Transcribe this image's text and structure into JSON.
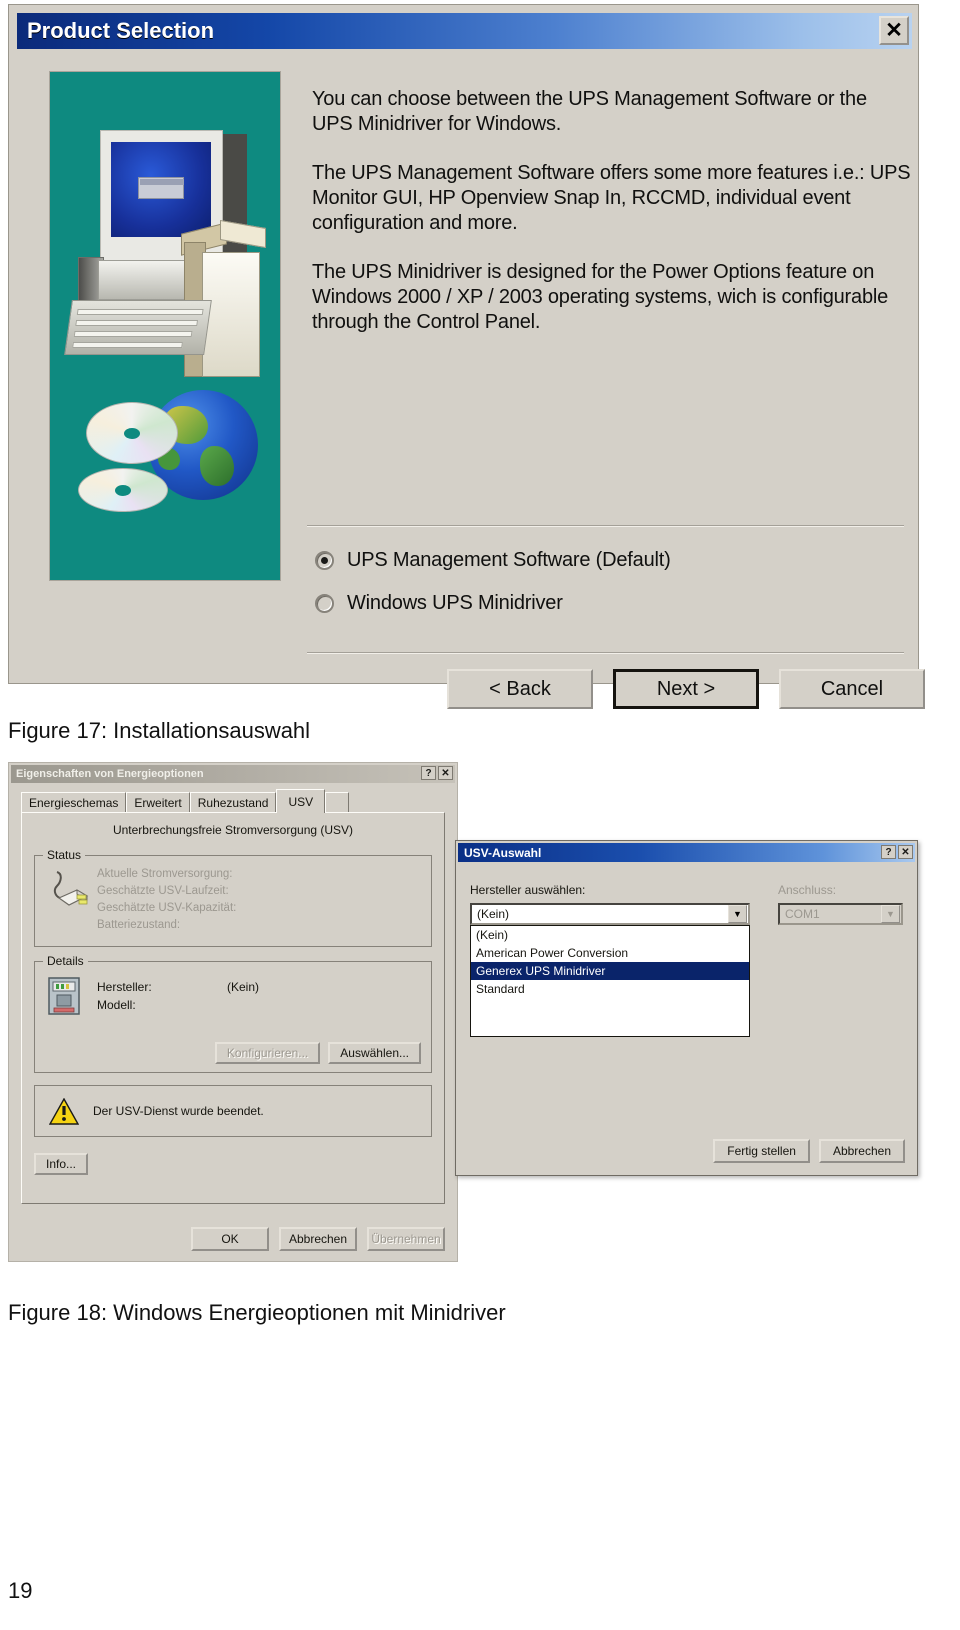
{
  "wizard": {
    "title": "Product Selection",
    "close_label": "✕",
    "paragraphs": [
      "You can choose between the UPS Management Software or the UPS Minidriver for Windows.",
      "The UPS Management Software offers some more features i.e.: UPS Monitor GUI, HP Openview Snap In, RCCMD, individual event configuration and more.",
      "The UPS Minidriver is designed for the Power Options feature on Windows 2000 / XP / 2003 operating systems, wich is configurable through the Control Panel."
    ],
    "options": [
      {
        "label": "UPS Management Software (Default)",
        "selected": true
      },
      {
        "label": "Windows UPS Minidriver",
        "selected": false
      }
    ],
    "buttons": {
      "back": "< Back",
      "next": "Next >",
      "cancel": "Cancel"
    },
    "colors": {
      "title_gradient_start": "#0b2a7a",
      "title_gradient_end": "#b8d2f0",
      "graphic_background": "#0e8a80",
      "dialog_face": "#d4d0c8"
    }
  },
  "captions": {
    "figure17": "Figure 17: Installationsauswahl",
    "figure18": "Figure 18: Windows Energieoptionen mit Minidriver"
  },
  "energie": {
    "title": "Eigenschaften von Energieoptionen",
    "help_label": "?",
    "close_label": "✕",
    "tabs": [
      {
        "label": "Energieschemas",
        "active": false
      },
      {
        "label": "Erweitert",
        "active": false
      },
      {
        "label": "Ruhezustand",
        "active": false
      },
      {
        "label": "USV",
        "active": true
      }
    ],
    "panel_heading": "Unterbrechungsfreie Stromversorgung (USV)",
    "status": {
      "group_label": "Status",
      "lines": [
        "Aktuelle Stromversorgung:",
        "Geschätzte USV-Laufzeit:",
        "Geschätzte USV-Kapazität:",
        "Batteriezustand:"
      ]
    },
    "details": {
      "group_label": "Details",
      "manufacturer_label": "Hersteller:",
      "manufacturer_value": "(Kein)",
      "model_label": "Modell:",
      "model_value": "",
      "configure_button": "Konfigurieren...",
      "select_button": "Auswählen..."
    },
    "warning": {
      "text": "Der USV-Dienst wurde beendet.",
      "icon": "warning-triangle"
    },
    "info_button": "Info...",
    "bottom_buttons": {
      "ok": "OK",
      "cancel": "Abbrechen",
      "apply": "Übernehmen"
    }
  },
  "usv_dialog": {
    "title": "USV-Auswahl",
    "help_label": "?",
    "close_label": "✕",
    "manufacturer_label": "Hersteller auswählen:",
    "manufacturer_value": "(Kein)",
    "dropdown_arrow": "▼",
    "options": [
      {
        "label": "(Kein)",
        "selected": false
      },
      {
        "label": "American Power Conversion",
        "selected": false
      },
      {
        "label": "Generex UPS Minidriver",
        "selected": true
      },
      {
        "label": "Standard",
        "selected": false
      }
    ],
    "port_label": "Anschluss:",
    "port_value": "COM1",
    "buttons": {
      "finish": "Fertig stellen",
      "cancel": "Abbrechen"
    },
    "colors": {
      "selection_blue": "#0a246a",
      "title_gradient_start": "#0a2f86"
    }
  },
  "page": {
    "number": "19"
  }
}
